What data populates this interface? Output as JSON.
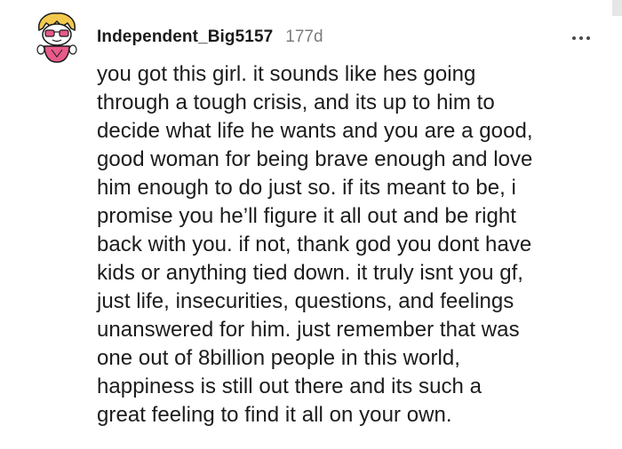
{
  "comment": {
    "username": "Independent_Big5157",
    "age": "177d",
    "more_icon": "more-horizontal-icon",
    "avatar_icon": "snoo-avatar-icon",
    "body_lines": [
      "you got this girl. it sounds like hes going",
      "through a tough crisis, and its up to him to",
      "decide what life he wants and you are a good,",
      "good woman for being brave enough and love",
      "him enough to do just so. if its meant to be, i",
      "promise you he’ll figure it all out and be right",
      "back with you. if not, thank god you dont have",
      "kids or anything tied down. it truly isnt you gf,",
      "just life, insecurities, questions, and feelings",
      "unanswered for him. just remember that was",
      "one out of 8billion people in this world,",
      "happiness is still out there and its such a",
      "great feeling to find it all on your own."
    ]
  },
  "colors": {
    "text": "#1c1c1c",
    "muted": "#7c7c7c",
    "avatar_hair": "#f2c94c",
    "avatar_body": "#e85a8a"
  }
}
